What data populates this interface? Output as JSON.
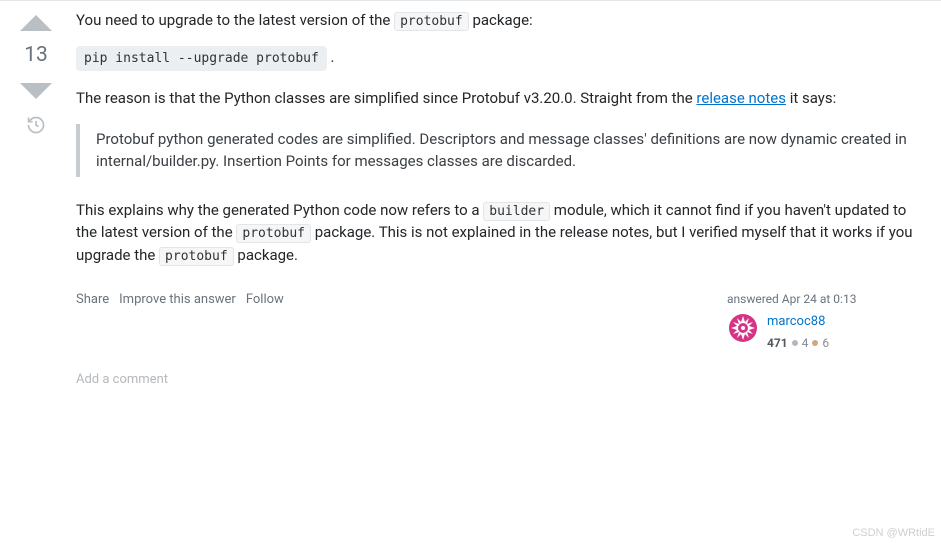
{
  "vote": {
    "score": "13"
  },
  "answer": {
    "p1_prefix": "You need to upgrade to the latest version of the ",
    "p1_code": "protobuf",
    "p1_suffix": " package:",
    "cmd": "pip install --upgrade protobuf",
    "p2_prefix": "The reason is that the Python classes are simplified since Protobuf v3.20.0. Straight from the ",
    "p2_link": "release notes",
    "p2_suffix": " it says:",
    "quote": "Protobuf python generated codes are simplified. Descriptors and message classes' definitions are now dynamic created in internal/builder.py. Insertion Points for messages classes are discarded.",
    "p3_a": "This explains why the generated Python code now refers to a ",
    "p3_code1": "builder",
    "p3_b": " module, which it cannot find if you haven't updated to the latest version of the ",
    "p3_code2": "protobuf",
    "p3_c": " package. This is not explained in the release notes, but I verified myself that it works if you upgrade the ",
    "p3_code3": "protobuf",
    "p3_d": " package."
  },
  "actions": {
    "share": "Share",
    "improve": "Improve this answer",
    "follow": "Follow"
  },
  "user": {
    "answered": "answered Apr 24 at 0:13",
    "name": "marcoc88",
    "rep": "471",
    "silver": "4",
    "bronze": "6"
  },
  "addComment": "Add a comment",
  "watermark": "CSDN @WRtidE"
}
